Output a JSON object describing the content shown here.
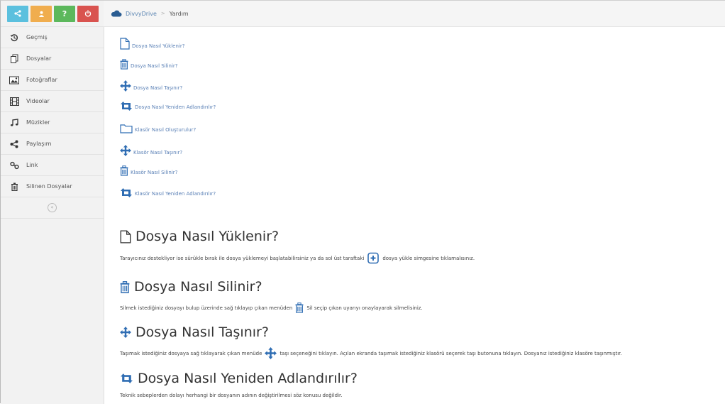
{
  "sidebar": {
    "buttons": [
      {
        "icon": "share-icon",
        "color": "#5bc0de"
      },
      {
        "icon": "user-icon",
        "color": "#f0ad4e"
      },
      {
        "icon": "help-icon",
        "color": "#5cb85c",
        "label": "?"
      },
      {
        "icon": "power-icon",
        "color": "#d9534f"
      }
    ],
    "items": [
      {
        "label": "Geçmiş",
        "icon": "history-icon"
      },
      {
        "label": "Dosyalar",
        "icon": "files-icon"
      },
      {
        "label": "Fotoğraflar",
        "icon": "photo-icon"
      },
      {
        "label": "Videolar",
        "icon": "film-icon"
      },
      {
        "label": "Müzikler",
        "icon": "music-icon"
      },
      {
        "label": "Paylaşım",
        "icon": "share-icon"
      },
      {
        "label": "Link",
        "icon": "link-icon"
      },
      {
        "label": "Silinen Dosyalar",
        "icon": "trash-icon"
      }
    ],
    "collapse_glyph": "«"
  },
  "breadcrumb": {
    "home": "DivvyDrive",
    "separator": ">",
    "current": "Yardım"
  },
  "toc": [
    {
      "label": "Dosya Nasıl Yüklenir?",
      "icon": "file-icon"
    },
    {
      "label": "Dosya Nasıl Silinir?",
      "icon": "trash-icon"
    },
    {
      "label": "Dosya Nasıl Taşınır?",
      "icon": "move-icon"
    },
    {
      "label": "Dosya Nasıl Yeniden Adlandırılır?",
      "icon": "retweet-icon"
    },
    {
      "label": "Klasör Nasıl Oluşturulur?",
      "icon": "folder-icon"
    },
    {
      "label": "Klasör Nasıl Taşınır?",
      "icon": "move-icon"
    },
    {
      "label": "Klasör Nasıl Silinir?",
      "icon": "trash-icon"
    },
    {
      "label": "Klasör Nasıl Yeniden Adlandırılır?",
      "icon": "retweet-icon"
    }
  ],
  "sections": [
    {
      "title": "Dosya Nasıl Yüklenir?",
      "icon": "file-icon",
      "text_before": "Tarayıcınız destekliyor ise sürükle bırak ile dosya yüklemeyi başlatabilirsiniz ya da sol üst taraftaki",
      "inline_icon": "upload-icon",
      "text_after": "dosya yükle simgesine tıklamalısınız."
    },
    {
      "title": "Dosya Nasıl Silinir?",
      "icon": "trash-icon",
      "text_before": "Silmek istediğiniz dosyayı bulup üzerinde sağ tıklayıp çıkan menüden",
      "inline_icon": "trash-icon",
      "text_after": "Sil seçip çıkan uyarıyı onaylayarak silmelisiniz."
    },
    {
      "title": "Dosya Nasıl Taşınır?",
      "icon": "move-icon",
      "text_before": "Taşımak istediğiniz dosyaya sağ tıklayarak çıkan menüde",
      "inline_icon": "move-icon",
      "text_after": "taşı seçeneğini tıklayın. Açılan ekranda taşımak istediğiniz klasörü seçerek taşı butonuna tıklayın. Dosyanız istediğiniz klasöre taşınmıştır."
    },
    {
      "title": "Dosya Nasıl Yeniden Adlandırılır?",
      "icon": "retweet-icon",
      "text_before": "Teknik sebeplerden dolayı herhangi bir dosyanın adının değiştirilmesi söz konusu değildir.",
      "inline_icon": "",
      "text_after": ""
    }
  ],
  "colors": {
    "link": "#5a80b6",
    "blue_icon": "#2f6db3",
    "dark_icon": "#222222"
  }
}
